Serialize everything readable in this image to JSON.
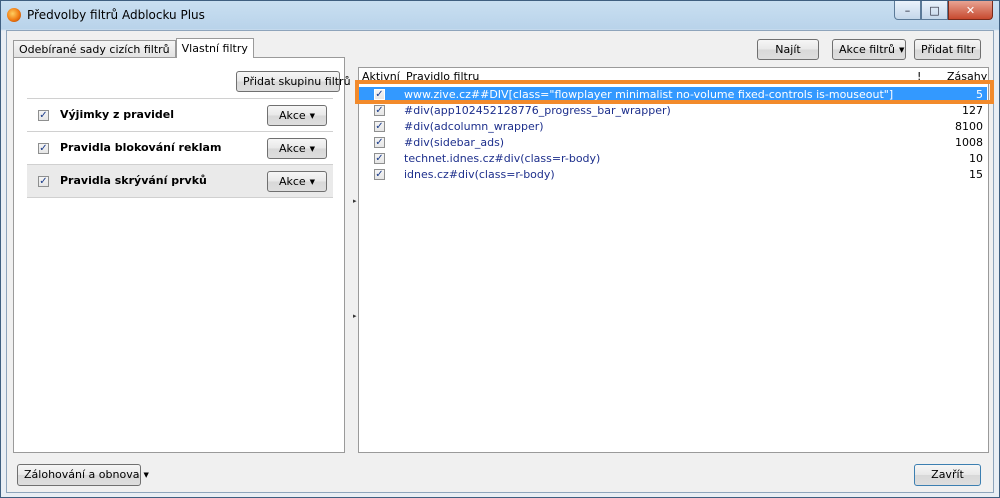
{
  "window": {
    "title": "Předvolby filtrů Adblocku Plus",
    "minimize": "–",
    "maximize": "□",
    "close": "✕"
  },
  "tabs": [
    {
      "label": "Odebírané sady cizích filtrů",
      "active": false
    },
    {
      "label": "Vlastní filtry",
      "active": true
    }
  ],
  "toolbar": {
    "add_group": "Přidat skupinu filtrů",
    "find": "Najít",
    "filter_actions": "Akce filtrů",
    "add_filter": "Přidat filtr"
  },
  "groups": [
    {
      "label": "Výjimky z pravidel",
      "checked": true,
      "action": "Akce"
    },
    {
      "label": "Pravidla blokování reklam",
      "checked": true,
      "action": "Akce"
    },
    {
      "label": "Pravidla skrývání prvků",
      "checked": true,
      "action": "Akce"
    }
  ],
  "columns": {
    "active": "Aktivní",
    "rule": "Pravidlo filtru",
    "flag": "!",
    "hits": "Zásahy"
  },
  "filters": [
    {
      "rule": "www.zive.cz##DIV[class=\"flowplayer minimalist no-volume fixed-controls is-mouseout\"]",
      "hits": "5",
      "checked": true,
      "selected": true
    },
    {
      "rule": "#div(app102452128776_progress_bar_wrapper)",
      "hits": "127",
      "checked": true,
      "selected": false
    },
    {
      "rule": "#div(adcolumn_wrapper)",
      "hits": "8100",
      "checked": true,
      "selected": false
    },
    {
      "rule": "#div(sidebar_ads)",
      "hits": "1008",
      "checked": true,
      "selected": false
    },
    {
      "rule": "technet.idnes.cz#div(class=r-body)",
      "hits": "10",
      "checked": true,
      "selected": false
    },
    {
      "rule": "idnes.cz#div(class=r-body)",
      "hits": "15",
      "checked": true,
      "selected": false
    }
  ],
  "footer": {
    "backup": "Zálohování a obnova",
    "close": "Zavřít"
  },
  "colors": {
    "selection": "#3399ff",
    "highlight": "#f28a2b",
    "rule_text": "#1d2f8c"
  }
}
